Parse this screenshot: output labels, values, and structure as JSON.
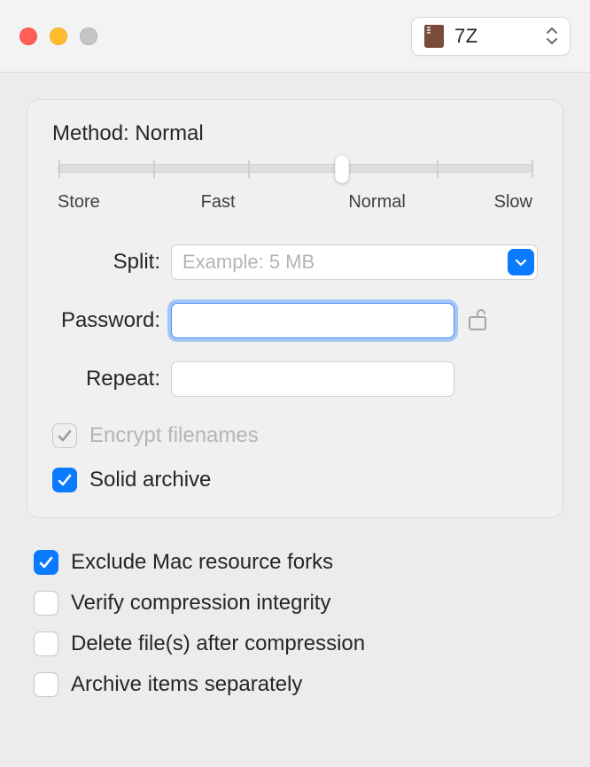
{
  "titlebar": {
    "format": {
      "label": "7Z"
    }
  },
  "panel": {
    "method_label": "Method:",
    "method_value": "Normal",
    "slider": {
      "ticks": [
        "Store",
        "Fast",
        "Normal",
        "Slow"
      ],
      "value_index": 3
    },
    "split": {
      "label": "Split:",
      "placeholder": "Example: 5 MB",
      "value": ""
    },
    "password": {
      "label": "Password:",
      "value": ""
    },
    "repeat": {
      "label": "Repeat:",
      "value": ""
    },
    "encrypt_filenames": {
      "label": "Encrypt filenames",
      "checked": true,
      "disabled": true
    },
    "solid_archive": {
      "label": "Solid archive",
      "checked": true
    }
  },
  "options": {
    "exclude_forks": {
      "label": "Exclude Mac resource forks",
      "checked": true
    },
    "verify_integrity": {
      "label": "Verify compression integrity",
      "checked": false
    },
    "delete_after": {
      "label": "Delete file(s) after compression",
      "checked": false
    },
    "archive_separately": {
      "label": "Archive items separately",
      "checked": false
    }
  }
}
